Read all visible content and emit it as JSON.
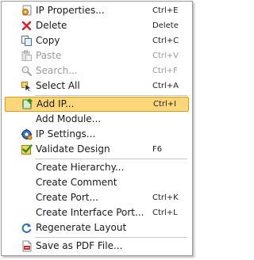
{
  "menu": {
    "items": [
      {
        "label": "IP Properties...",
        "shortcut": "Ctrl+E",
        "icon": "ip-properties-icon"
      },
      {
        "label": "Delete",
        "shortcut": "Delete",
        "icon": "delete-x-icon"
      },
      {
        "label": "Copy",
        "shortcut": "Ctrl+C",
        "icon": "copy-icon"
      },
      {
        "label": "Paste",
        "shortcut": "Ctrl+V",
        "icon": "paste-icon",
        "disabled": true
      },
      {
        "label": "Search...",
        "shortcut": "Ctrl+F",
        "icon": "search-icon",
        "disabled": true
      },
      {
        "label": "Select All",
        "shortcut": "Ctrl+A",
        "icon": "select-all-icon"
      },
      {
        "label": "Add IP...",
        "shortcut": "Ctrl+I",
        "icon": "add-ip-icon",
        "highlighted": true
      },
      {
        "label": "Add Module...",
        "shortcut": "",
        "icon": ""
      },
      {
        "label": "IP Settings...",
        "shortcut": "",
        "icon": "ip-settings-icon"
      },
      {
        "label": "Validate Design",
        "shortcut": "F6",
        "icon": "validate-icon"
      },
      {
        "label": "Create Hierarchy...",
        "shortcut": "",
        "icon": ""
      },
      {
        "label": "Create Comment",
        "shortcut": "",
        "icon": ""
      },
      {
        "label": "Create Port...",
        "shortcut": "Ctrl+K",
        "icon": ""
      },
      {
        "label": "Create Interface Port...",
        "shortcut": "Ctrl+L",
        "icon": ""
      },
      {
        "label": "Regenerate Layout",
        "shortcut": "",
        "icon": "regenerate-icon"
      },
      {
        "label": "Save as PDF File...",
        "shortcut": "",
        "icon": "pdf-icon"
      }
    ]
  }
}
